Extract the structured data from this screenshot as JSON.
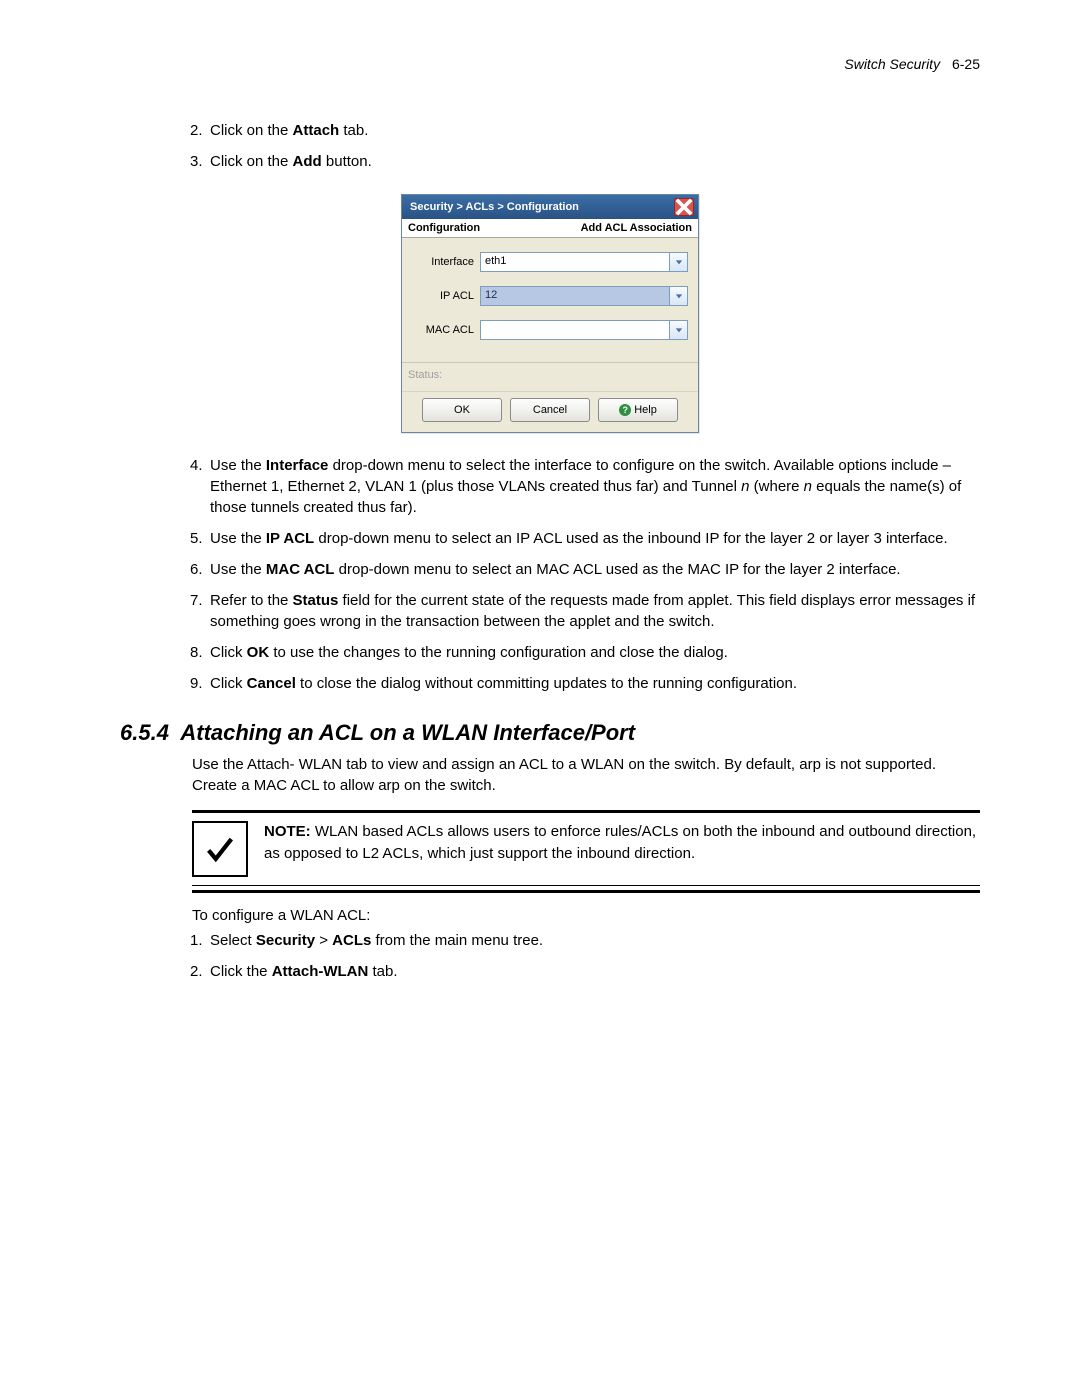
{
  "header": {
    "chapter": "Switch Security",
    "page_num": "6-25"
  },
  "steps_top": [
    {
      "num": "2.",
      "pre": "Click on the ",
      "bold": "Attach",
      "post": " tab."
    },
    {
      "num": "3.",
      "pre": "Click on the ",
      "bold": "Add",
      "post": " button."
    }
  ],
  "dialog": {
    "title": "Security > ACLs > Configuration",
    "sub_left": "Configuration",
    "sub_right": "Add ACL Association",
    "fields": {
      "interface": {
        "label": "Interface",
        "value": "eth1"
      },
      "ip_acl": {
        "label": "IP ACL",
        "value": "12"
      },
      "mac_acl": {
        "label": "MAC ACL",
        "value": ""
      }
    },
    "status_label": "Status:",
    "buttons": {
      "ok": "OK",
      "cancel": "Cancel",
      "help": "Help"
    }
  },
  "steps_mid": [
    {
      "num": "4.",
      "parts": [
        {
          "t": "Use the "
        },
        {
          "t": "Interface",
          "b": true
        },
        {
          "t": " drop-down menu to select the interface to configure on the switch. Available options include – Ethernet 1, Ethernet 2, VLAN 1 (plus those VLANs created thus far) and Tunnel "
        },
        {
          "t": "n",
          "i": true
        },
        {
          "t": " (where "
        },
        {
          "t": "n",
          "i": true
        },
        {
          "t": " equals the name(s) of those tunnels created thus far)."
        }
      ]
    },
    {
      "num": "5.",
      "parts": [
        {
          "t": "Use the "
        },
        {
          "t": "IP ACL",
          "b": true
        },
        {
          "t": " drop-down menu to select an IP ACL used as the inbound IP for the layer 2 or layer 3 interface."
        }
      ]
    },
    {
      "num": "6.",
      "parts": [
        {
          "t": "Use the "
        },
        {
          "t": "MAC ACL",
          "b": true
        },
        {
          "t": " drop-down menu to select an MAC ACL used as the MAC IP for the layer 2 interface."
        }
      ]
    },
    {
      "num": "7.",
      "parts": [
        {
          "t": "Refer to the "
        },
        {
          "t": "Status",
          "b": true
        },
        {
          "t": " field for the current state of the requests made from applet. This field displays error messages if something goes wrong in the transaction between the applet and the switch."
        }
      ]
    },
    {
      "num": "8.",
      "parts": [
        {
          "t": "Click "
        },
        {
          "t": "OK",
          "b": true
        },
        {
          "t": " to use the changes to the running configuration and close the dialog."
        }
      ]
    },
    {
      "num": "9.",
      "parts": [
        {
          "t": "Click "
        },
        {
          "t": "Cancel",
          "b": true
        },
        {
          "t": " to close the dialog without committing updates to the running configuration."
        }
      ]
    }
  ],
  "section": {
    "number": "6.5.4",
    "title": "Attaching an ACL on a WLAN Interface/Port",
    "intro": "Use the Attach- WLAN tab to view and assign an ACL to a WLAN on the switch. By default, arp is not supported. Create a MAC ACL to allow arp on the switch."
  },
  "note": {
    "label": "NOTE:",
    "text": " WLAN based ACLs allows users to enforce rules/ACLs on both the inbound and outbound direction, as opposed to L2 ACLs, which just support the inbound direction."
  },
  "after_note": "To configure a WLAN ACL:",
  "steps_bottom": [
    {
      "num": "1.",
      "parts": [
        {
          "t": "Select "
        },
        {
          "t": "Security",
          "b": true
        },
        {
          "t": " > "
        },
        {
          "t": "ACLs",
          "b": true
        },
        {
          "t": " from the main menu tree."
        }
      ]
    },
    {
      "num": "2.",
      "parts": [
        {
          "t": "Click the "
        },
        {
          "t": "Attach-WLAN",
          "b": true
        },
        {
          "t": " tab."
        }
      ]
    }
  ]
}
